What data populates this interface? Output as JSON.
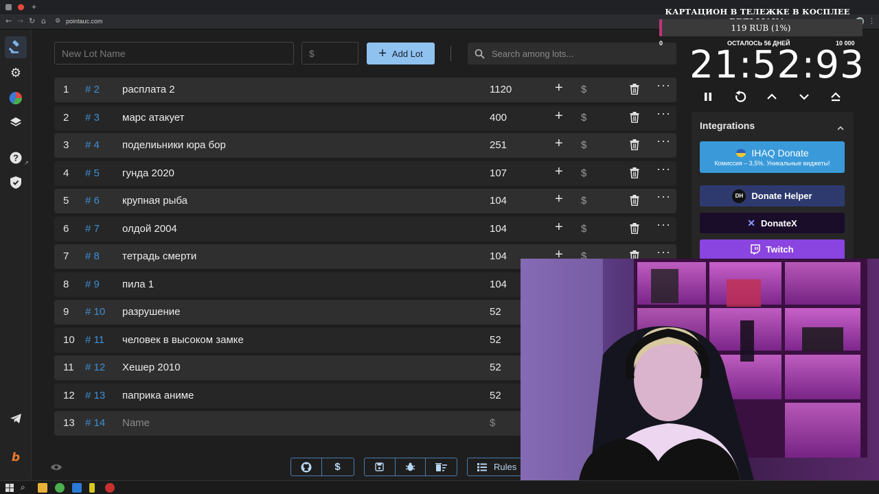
{
  "browser": {
    "url": "pointauc.com"
  },
  "sidebar": {
    "items": [
      {
        "icon": "gavel-icon",
        "active": true
      },
      {
        "icon": "gear-icon"
      },
      {
        "icon": "pie-chart-icon"
      },
      {
        "icon": "layers-icon"
      },
      {
        "icon": "help-icon"
      },
      {
        "icon": "shield-icon"
      },
      {
        "icon": "telegram-icon"
      },
      {
        "icon": "boosty-icon"
      }
    ]
  },
  "form": {
    "lot_name_placeholder": "New Lot Name",
    "amount_placeholder": "$",
    "add_lot_label": "Add Lot",
    "search_placeholder": "Search among lots..."
  },
  "lots": [
    {
      "num": "1",
      "id": "# 2",
      "name": "расплата 2",
      "amount": "1120"
    },
    {
      "num": "2",
      "id": "# 3",
      "name": "марс атакует",
      "amount": "400"
    },
    {
      "num": "3",
      "id": "# 4",
      "name": "поделиьники юра бор",
      "amount": "251"
    },
    {
      "num": "4",
      "id": "# 5",
      "name": "гунда 2020",
      "amount": "107"
    },
    {
      "num": "5",
      "id": "# 6",
      "name": "крупная рыба",
      "amount": "104"
    },
    {
      "num": "6",
      "id": "# 7",
      "name": "олдой 2004",
      "amount": "104"
    },
    {
      "num": "7",
      "id": "# 8",
      "name": "тетрадь смерти",
      "amount": "104"
    },
    {
      "num": "8",
      "id": "# 9",
      "name": "пила 1",
      "amount": "104"
    },
    {
      "num": "9",
      "id": "# 10",
      "name": "разрушение",
      "amount": "52"
    },
    {
      "num": "10",
      "id": "# 11",
      "name": "человек в высоком замке",
      "amount": "52"
    },
    {
      "num": "11",
      "id": "# 12",
      "name": "Хешер 2010",
      "amount": "52"
    },
    {
      "num": "12",
      "id": "# 13",
      "name": "паприка аниме",
      "amount": "52"
    }
  ],
  "new_row": {
    "num": "13",
    "id": "# 14",
    "name_placeholder": "Name",
    "amount_placeholder": "$"
  },
  "row_actions": {
    "plus": "+",
    "dollar": "$",
    "more": "···"
  },
  "bottom_bar": {
    "rules_label": "Rules"
  },
  "overlay": {
    "title": "КАРТАЦИОН В ТЕЛЕЖКЕ В КОСПЛЕЕ ВЕДЬМАКА",
    "goal_text": "119 RUB (1%)",
    "goal_progress": 0.012,
    "goal_min": "0",
    "goal_max": "10 000",
    "remaining": "ОСТАЛОСЬ 56 ДНЕЙ",
    "timer": "21:52:93"
  },
  "integrations": {
    "title": "Integrations",
    "ihaq": {
      "label": "IHAQ Donate",
      "sub": "Комиссия – 3,5%. Уникальные виджеты!",
      "color": "#3a9ad9"
    },
    "donate_helper": {
      "label": "Donate Helper",
      "badge": "DH",
      "color": "#2e3a6e"
    },
    "donatex": {
      "label": "DonateX",
      "color": "#1a0d2a"
    },
    "twitch": {
      "label": "Twitch",
      "color": "#8a44e0"
    }
  }
}
